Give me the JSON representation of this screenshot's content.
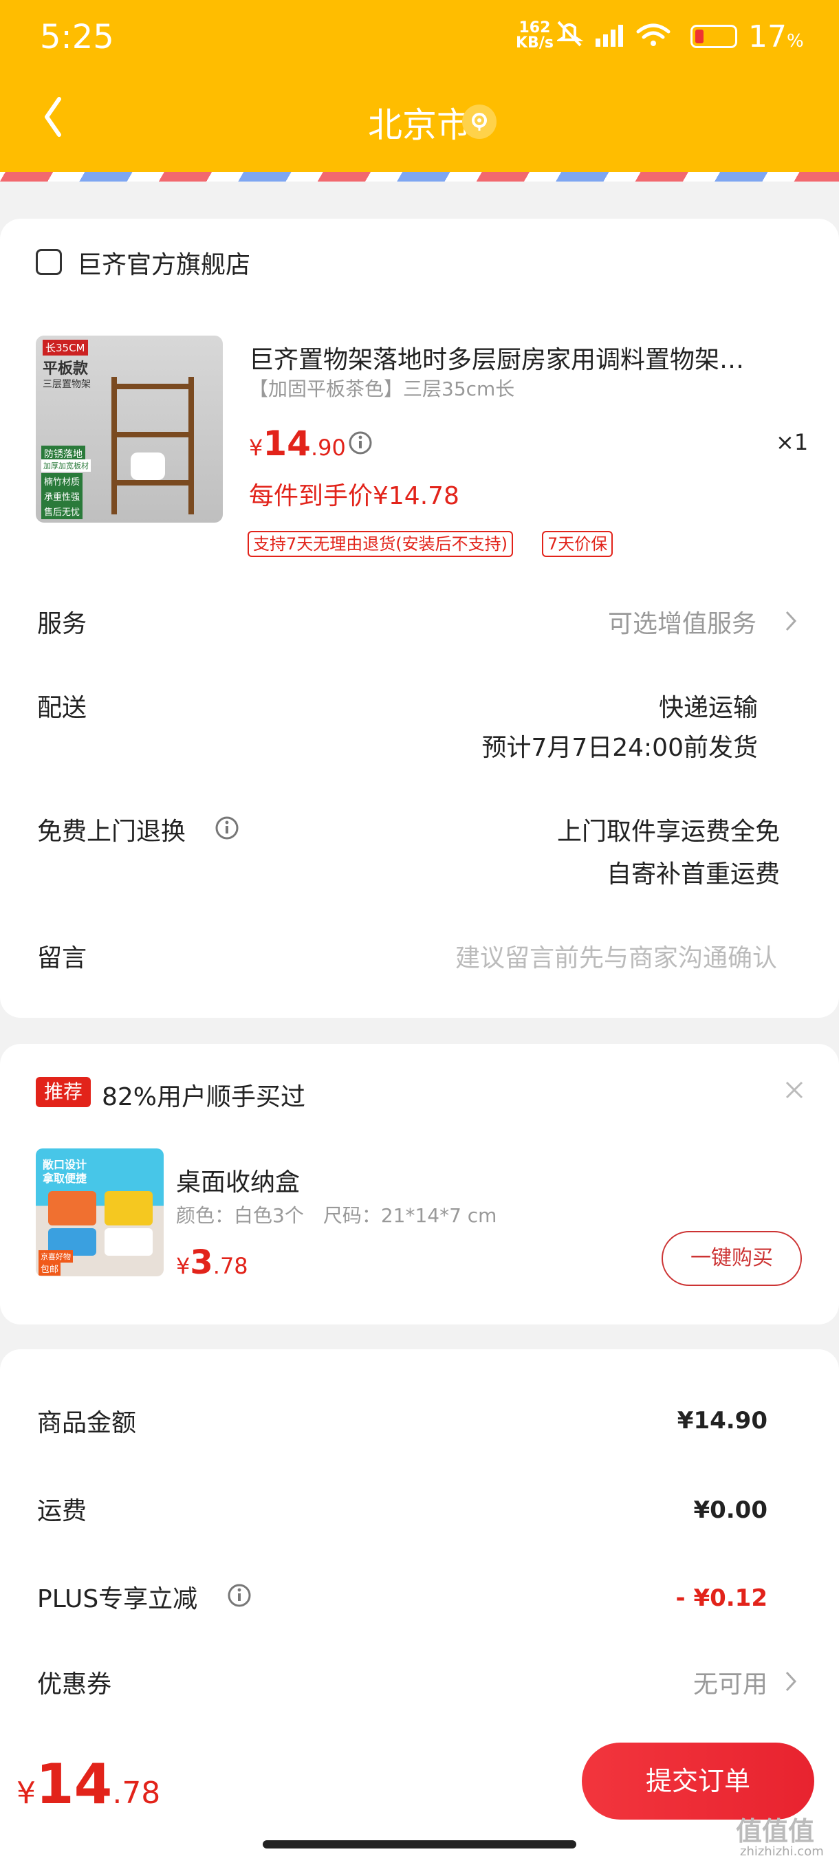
{
  "status_bar": {
    "time": "5:25",
    "net_speed_value": "162",
    "net_speed_unit": "KB/s",
    "battery": "17",
    "battery_unit": "%"
  },
  "header": {
    "city": "北京市"
  },
  "store": {
    "name": "巨齐官方旗舰店"
  },
  "product": {
    "title": "巨齐置物架落地时多层厨房家用调料置物架…",
    "spec": "【加固平板茶色】三层35cm长",
    "price_symbol": "¥",
    "price_int": "14",
    "price_dec": ".90",
    "qty": "×1",
    "final_price": "每件到手价¥14.78",
    "tags": [
      "支持7天无理由退货(安装后不支持)",
      "7天价保"
    ],
    "thumb_labels": [
      "长35CM",
      "平板款",
      "三层置物架",
      "防锈落地",
      "加厚加宽板材",
      "楠竹材质",
      "承重性强",
      "售后无忧"
    ]
  },
  "rows": {
    "service_label": "服务",
    "service_value": "可选增值服务",
    "delivery_label": "配送",
    "delivery_value": "快递运输",
    "delivery_eta": "预计7月7日24:00前发货",
    "return_label": "免费上门退换",
    "return_value1": "上门取件享运费全免",
    "return_value2": "自寄补首重运费",
    "note_label": "留言",
    "note_placeholder": "建议留言前先与商家沟通确认"
  },
  "recommend": {
    "badge": "推荐",
    "title": "82%用户顺手买过",
    "item_name": "桌面收纳盒",
    "item_spec": "颜色：白色3个　尺码：21*14*7 cm",
    "price_symbol": "¥",
    "price_int": "3",
    "price_dec": ".78",
    "buy_button": "一键购买",
    "thumb_labels": [
      "敞口设计",
      "拿取便捷",
      "京喜好物",
      "包邮"
    ]
  },
  "summary": {
    "goods_label": "商品金额",
    "goods_value": "¥14.90",
    "shipping_label": "运费",
    "shipping_value": "¥0.00",
    "plus_label": "PLUS专享立减",
    "plus_value": "- ¥0.12",
    "coupon_label": "优惠券",
    "coupon_value": "无可用"
  },
  "bottom": {
    "price_symbol": "¥",
    "price_int": "14",
    "price_dec": ".78",
    "submit": "提交订单"
  },
  "watermark": {
    "logo": "值值值",
    "domain": "zhizhizhi.com"
  },
  "colors": {
    "header": "#ffbd00",
    "accent_red": "#e2231a",
    "submit_red": "#f2353d"
  }
}
